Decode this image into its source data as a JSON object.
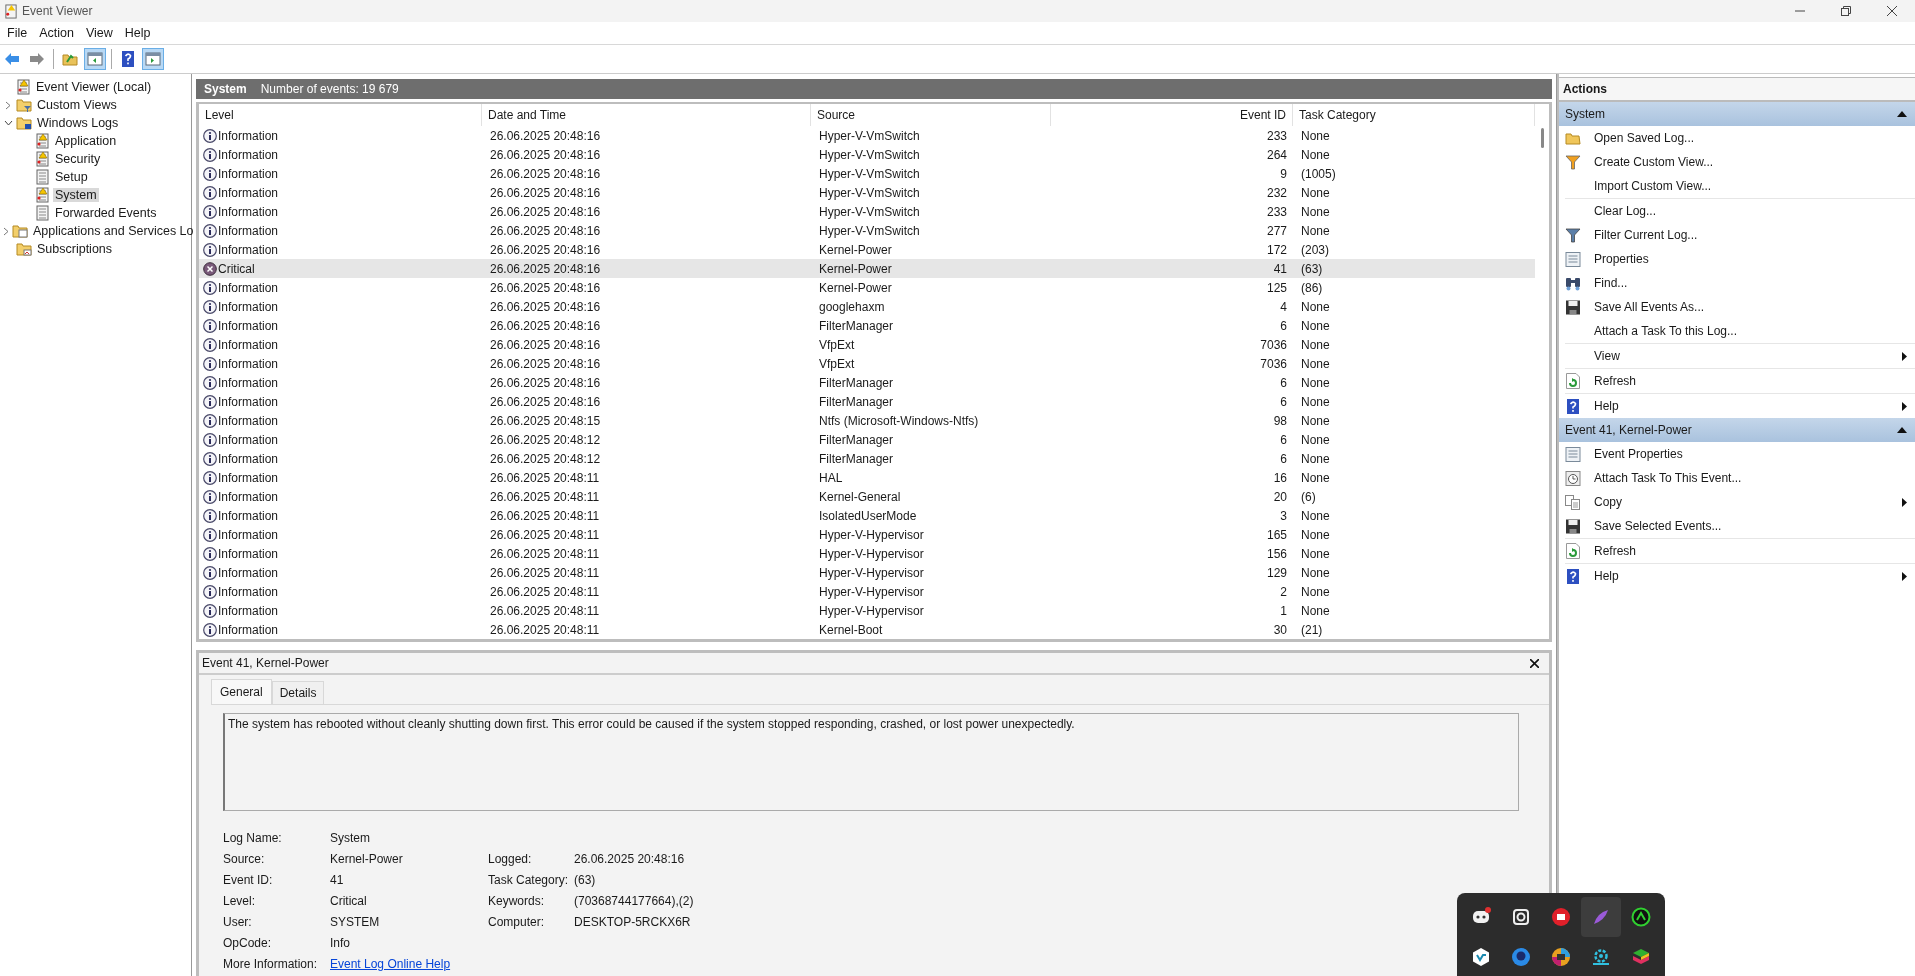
{
  "window": {
    "title": "Event Viewer"
  },
  "menu": [
    "File",
    "Action",
    "View",
    "Help"
  ],
  "toolbar": [
    {
      "kind": "back",
      "pressed": false
    },
    {
      "kind": "forward",
      "pressed": false
    },
    {
      "kind": "separator"
    },
    {
      "kind": "folder-up",
      "pressed": false
    },
    {
      "kind": "tree-pane",
      "pressed": true
    },
    {
      "kind": "separator"
    },
    {
      "kind": "help",
      "pressed": false
    },
    {
      "kind": "action-pane",
      "pressed": true
    }
  ],
  "tree": [
    {
      "label": "Event Viewer (Local)",
      "kind": "root",
      "selected": false,
      "children": [
        {
          "label": "Custom Views",
          "kind": "filter-folder",
          "expanded": false,
          "selected": false
        },
        {
          "label": "Windows Logs",
          "kind": "logs-folder",
          "expanded": true,
          "selected": false,
          "children": [
            {
              "label": "Application",
              "kind": "log",
              "selected": false
            },
            {
              "label": "Security",
              "kind": "log",
              "selected": false
            },
            {
              "label": "Setup",
              "kind": "plain-log",
              "selected": false
            },
            {
              "label": "System",
              "kind": "log",
              "selected": true
            },
            {
              "label": "Forwarded Events",
              "kind": "plain-log",
              "selected": false
            }
          ]
        },
        {
          "label": "Applications and Services Lo",
          "kind": "folder",
          "expanded": false,
          "selected": false
        },
        {
          "label": "Subscriptions",
          "kind": "subscription-folder",
          "selected": false
        }
      ]
    }
  ],
  "log_header": {
    "name": "System",
    "count": "Number of events: 19 679"
  },
  "table": {
    "columns": [
      "Level",
      "Date and Time",
      "Source",
      "Event ID",
      "Task Category"
    ],
    "rows": [
      {
        "kind": "information",
        "level_label": "Information",
        "date": "26.06.2025 20:48:16",
        "source": "Hyper-V-VmSwitch",
        "event_id": "233",
        "task_category": "None",
        "selected": false
      },
      {
        "kind": "information",
        "level_label": "Information",
        "date": "26.06.2025 20:48:16",
        "source": "Hyper-V-VmSwitch",
        "event_id": "264",
        "task_category": "None",
        "selected": false
      },
      {
        "kind": "information",
        "level_label": "Information",
        "date": "26.06.2025 20:48:16",
        "source": "Hyper-V-VmSwitch",
        "event_id": "9",
        "task_category": "(1005)",
        "selected": false
      },
      {
        "kind": "information",
        "level_label": "Information",
        "date": "26.06.2025 20:48:16",
        "source": "Hyper-V-VmSwitch",
        "event_id": "232",
        "task_category": "None",
        "selected": false
      },
      {
        "kind": "information",
        "level_label": "Information",
        "date": "26.06.2025 20:48:16",
        "source": "Hyper-V-VmSwitch",
        "event_id": "233",
        "task_category": "None",
        "selected": false
      },
      {
        "kind": "information",
        "level_label": "Information",
        "date": "26.06.2025 20:48:16",
        "source": "Hyper-V-VmSwitch",
        "event_id": "277",
        "task_category": "None",
        "selected": false
      },
      {
        "kind": "information",
        "level_label": "Information",
        "date": "26.06.2025 20:48:16",
        "source": "Kernel-Power",
        "event_id": "172",
        "task_category": "(203)",
        "selected": false
      },
      {
        "kind": "critical",
        "level_label": "Critical",
        "date": "26.06.2025 20:48:16",
        "source": "Kernel-Power",
        "event_id": "41",
        "task_category": "(63)",
        "selected": true
      },
      {
        "kind": "information",
        "level_label": "Information",
        "date": "26.06.2025 20:48:16",
        "source": "Kernel-Power",
        "event_id": "125",
        "task_category": "(86)",
        "selected": false
      },
      {
        "kind": "information",
        "level_label": "Information",
        "date": "26.06.2025 20:48:16",
        "source": "googlehaxm",
        "event_id": "4",
        "task_category": "None",
        "selected": false
      },
      {
        "kind": "information",
        "level_label": "Information",
        "date": "26.06.2025 20:48:16",
        "source": "FilterManager",
        "event_id": "6",
        "task_category": "None",
        "selected": false
      },
      {
        "kind": "information",
        "level_label": "Information",
        "date": "26.06.2025 20:48:16",
        "source": "VfpExt",
        "event_id": "7036",
        "task_category": "None",
        "selected": false
      },
      {
        "kind": "information",
        "level_label": "Information",
        "date": "26.06.2025 20:48:16",
        "source": "VfpExt",
        "event_id": "7036",
        "task_category": "None",
        "selected": false
      },
      {
        "kind": "information",
        "level_label": "Information",
        "date": "26.06.2025 20:48:16",
        "source": "FilterManager",
        "event_id": "6",
        "task_category": "None",
        "selected": false
      },
      {
        "kind": "information",
        "level_label": "Information",
        "date": "26.06.2025 20:48:16",
        "source": "FilterManager",
        "event_id": "6",
        "task_category": "None",
        "selected": false
      },
      {
        "kind": "information",
        "level_label": "Information",
        "date": "26.06.2025 20:48:15",
        "source": "Ntfs (Microsoft-Windows-Ntfs)",
        "event_id": "98",
        "task_category": "None",
        "selected": false
      },
      {
        "kind": "information",
        "level_label": "Information",
        "date": "26.06.2025 20:48:12",
        "source": "FilterManager",
        "event_id": "6",
        "task_category": "None",
        "selected": false
      },
      {
        "kind": "information",
        "level_label": "Information",
        "date": "26.06.2025 20:48:12",
        "source": "FilterManager",
        "event_id": "6",
        "task_category": "None",
        "selected": false
      },
      {
        "kind": "information",
        "level_label": "Information",
        "date": "26.06.2025 20:48:11",
        "source": "HAL",
        "event_id": "16",
        "task_category": "None",
        "selected": false
      },
      {
        "kind": "information",
        "level_label": "Information",
        "date": "26.06.2025 20:48:11",
        "source": "Kernel-General",
        "event_id": "20",
        "task_category": "(6)",
        "selected": false
      },
      {
        "kind": "information",
        "level_label": "Information",
        "date": "26.06.2025 20:48:11",
        "source": "IsolatedUserMode",
        "event_id": "3",
        "task_category": "None",
        "selected": false
      },
      {
        "kind": "information",
        "level_label": "Information",
        "date": "26.06.2025 20:48:11",
        "source": "Hyper-V-Hypervisor",
        "event_id": "165",
        "task_category": "None",
        "selected": false
      },
      {
        "kind": "information",
        "level_label": "Information",
        "date": "26.06.2025 20:48:11",
        "source": "Hyper-V-Hypervisor",
        "event_id": "156",
        "task_category": "None",
        "selected": false
      },
      {
        "kind": "information",
        "level_label": "Information",
        "date": "26.06.2025 20:48:11",
        "source": "Hyper-V-Hypervisor",
        "event_id": "129",
        "task_category": "None",
        "selected": false
      },
      {
        "kind": "information",
        "level_label": "Information",
        "date": "26.06.2025 20:48:11",
        "source": "Hyper-V-Hypervisor",
        "event_id": "2",
        "task_category": "None",
        "selected": false
      },
      {
        "kind": "information",
        "level_label": "Information",
        "date": "26.06.2025 20:48:11",
        "source": "Hyper-V-Hypervisor",
        "event_id": "1",
        "task_category": "None",
        "selected": false
      },
      {
        "kind": "information",
        "level_label": "Information",
        "date": "26.06.2025 20:48:11",
        "source": "Kernel-Boot",
        "event_id": "30",
        "task_category": "(21)",
        "selected": false
      }
    ]
  },
  "detail": {
    "title": "Event 41, Kernel-Power",
    "tabs": [
      {
        "label": "General",
        "selected": true
      },
      {
        "label": "Details",
        "selected": false
      }
    ],
    "description": "The system has rebooted without cleanly shutting down first. This error could be caused if the system stopped responding, crashed, or lost power unexpectedly.",
    "fields_left": [
      {
        "label": "Log Name:",
        "value": "System",
        "kind": "text"
      },
      {
        "label": "Source:",
        "value": "Kernel-Power",
        "kind": "text"
      },
      {
        "label": "Event ID:",
        "value": "41",
        "kind": "text"
      },
      {
        "label": "Level:",
        "value": "Critical",
        "kind": "text"
      },
      {
        "label": "User:",
        "value": "SYSTEM",
        "kind": "text"
      },
      {
        "label": "OpCode:",
        "value": "Info",
        "kind": "text"
      },
      {
        "label": "More Information:",
        "value": "Event Log Online Help",
        "kind": "link"
      }
    ],
    "fields_right": [
      {
        "label": "Logged:",
        "value": "26.06.2025 20:48:16"
      },
      {
        "label": "Task Category:",
        "value": "(63)"
      },
      {
        "label": "Keywords:",
        "value": "(70368744177664),(2)"
      },
      {
        "label": "Computer:",
        "value": "DESKTOP-5RCKX6R"
      }
    ]
  },
  "actions": {
    "title": "Actions",
    "sections": [
      {
        "title": "System",
        "items": [
          {
            "label": "Open Saved Log...",
            "kind": "folder",
            "submenu": false,
            "divider_after": false
          },
          {
            "label": "Create Custom View...",
            "kind": "filter-color",
            "submenu": false,
            "divider_after": false
          },
          {
            "label": "Import Custom View...",
            "kind": "plain",
            "submenu": false,
            "divider_after": true
          },
          {
            "label": "Clear Log...",
            "kind": "plain",
            "submenu": false,
            "divider_after": false
          },
          {
            "label": "Filter Current Log...",
            "kind": "filter",
            "submenu": false,
            "divider_after": false
          },
          {
            "label": "Properties",
            "kind": "properties",
            "submenu": false,
            "divider_after": false
          },
          {
            "label": "Find...",
            "kind": "binoculars",
            "submenu": false,
            "divider_after": false
          },
          {
            "label": "Save All Events As...",
            "kind": "save",
            "submenu": false,
            "divider_after": false
          },
          {
            "label": "Attach a Task To this Log...",
            "kind": "plain",
            "submenu": false,
            "divider_after": true
          },
          {
            "label": "View",
            "kind": "plain",
            "submenu": true,
            "divider_after": true
          },
          {
            "label": "Refresh",
            "kind": "refresh",
            "submenu": false,
            "divider_after": true
          },
          {
            "label": "Help",
            "kind": "help",
            "submenu": true,
            "divider_after": false
          }
        ]
      },
      {
        "title": "Event 41, Kernel-Power",
        "items": [
          {
            "label": "Event Properties",
            "kind": "properties",
            "submenu": false,
            "divider_after": false
          },
          {
            "label": "Attach Task To This Event...",
            "kind": "clock",
            "submenu": false,
            "divider_after": false
          },
          {
            "label": "Copy",
            "kind": "copy",
            "submenu": true,
            "divider_after": false
          },
          {
            "label": "Save Selected Events...",
            "kind": "save",
            "submenu": false,
            "divider_after": true
          },
          {
            "label": "Refresh",
            "kind": "refresh",
            "submenu": false,
            "divider_after": true
          },
          {
            "label": "Help",
            "kind": "help",
            "submenu": true,
            "divider_after": false
          }
        ]
      }
    ]
  },
  "tray": [
    {
      "kind": "chat",
      "hovered": false
    },
    {
      "kind": "camera",
      "hovered": false
    },
    {
      "kind": "red-circle",
      "hovered": false
    },
    {
      "kind": "feather",
      "hovered": true
    },
    {
      "kind": "green-ring",
      "hovered": false
    },
    {
      "kind": "hexagon",
      "hovered": false
    },
    {
      "kind": "blue-circle",
      "hovered": false
    },
    {
      "kind": "multicolor",
      "hovered": false
    },
    {
      "kind": "gear",
      "hovered": false
    },
    {
      "kind": "stack",
      "hovered": false
    }
  ]
}
